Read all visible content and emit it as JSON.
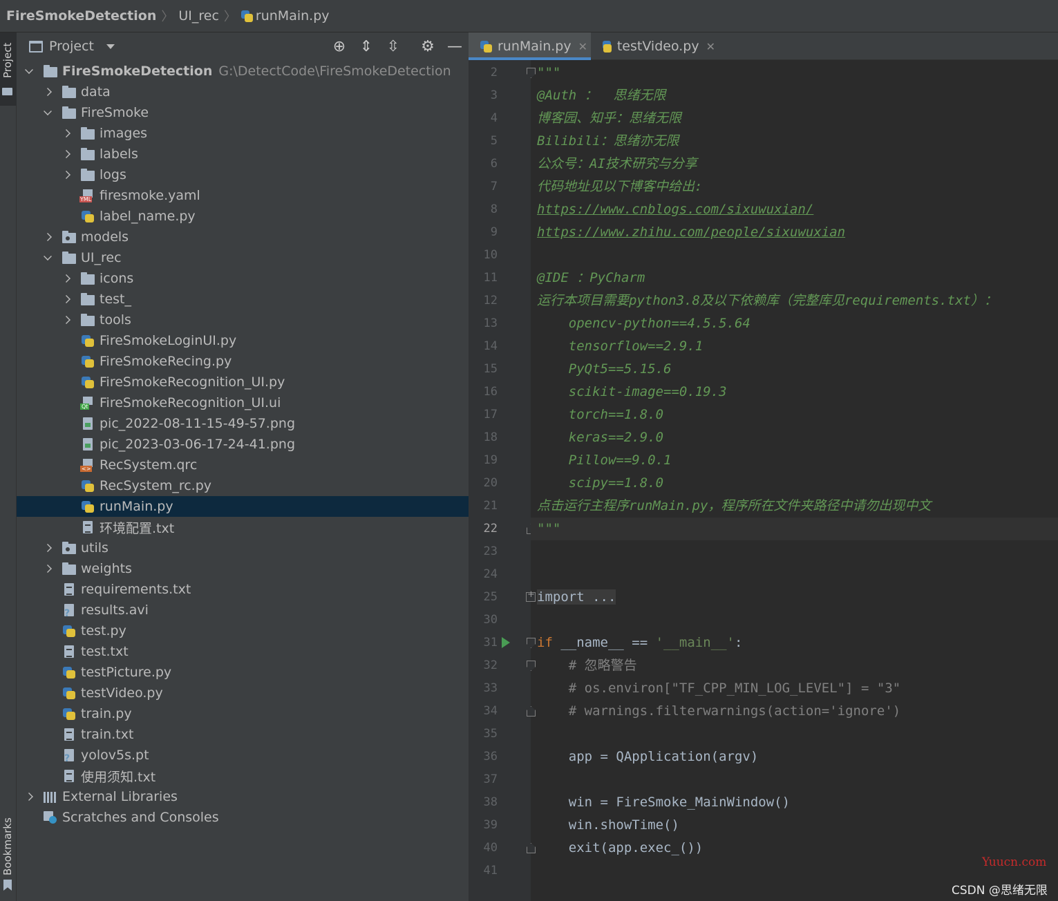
{
  "breadcrumb": [
    "FireSmokeDetection",
    "UI_rec",
    "runMain.py"
  ],
  "left_stripe": {
    "project_label": "Project",
    "bookmarks_label": "Bookmarks"
  },
  "project_panel": {
    "title": "Project",
    "tree": [
      {
        "name": "FireSmokeDetection",
        "path": "G:\\DetectCode\\FireSmokeDetection",
        "level": 0,
        "chevron": "down",
        "icon": "folder-icon",
        "bold": true
      },
      {
        "name": "data",
        "level": 1,
        "chevron": "right",
        "icon": "folder-icon"
      },
      {
        "name": "FireSmoke",
        "level": 1,
        "chevron": "down",
        "icon": "folder-icon"
      },
      {
        "name": "images",
        "level": 2,
        "chevron": "right",
        "icon": "folder-icon"
      },
      {
        "name": "labels",
        "level": 2,
        "chevron": "right",
        "icon": "folder-icon"
      },
      {
        "name": "logs",
        "level": 2,
        "chevron": "right",
        "icon": "folder-icon"
      },
      {
        "name": "firesmoke.yaml",
        "level": 2,
        "chevron": "none",
        "icon": "yaml-file-icon"
      },
      {
        "name": "label_name.py",
        "level": 2,
        "chevron": "none",
        "icon": "python-file-icon"
      },
      {
        "name": "models",
        "level": 1,
        "chevron": "right",
        "icon": "package-folder-icon"
      },
      {
        "name": "UI_rec",
        "level": 1,
        "chevron": "down",
        "icon": "folder-icon"
      },
      {
        "name": "icons",
        "level": 2,
        "chevron": "right",
        "icon": "folder-icon"
      },
      {
        "name": "test_",
        "level": 2,
        "chevron": "right",
        "icon": "folder-icon"
      },
      {
        "name": "tools",
        "level": 2,
        "chevron": "right",
        "icon": "folder-icon"
      },
      {
        "name": "FireSmokeLoginUI.py",
        "level": 2,
        "chevron": "none",
        "icon": "python-file-icon"
      },
      {
        "name": "FireSmokeRecing.py",
        "level": 2,
        "chevron": "none",
        "icon": "python-file-icon"
      },
      {
        "name": "FireSmokeRecognition_UI.py",
        "level": 2,
        "chevron": "none",
        "icon": "python-file-icon"
      },
      {
        "name": "FireSmokeRecognition_UI.ui",
        "level": 2,
        "chevron": "none",
        "icon": "qt-ui-file-icon"
      },
      {
        "name": "pic_2022-08-11-15-49-57.png",
        "level": 2,
        "chevron": "none",
        "icon": "image-file-icon"
      },
      {
        "name": "pic_2023-03-06-17-24-41.png",
        "level": 2,
        "chevron": "none",
        "icon": "image-file-icon"
      },
      {
        "name": "RecSystem.qrc",
        "level": 2,
        "chevron": "none",
        "icon": "qrc-file-icon"
      },
      {
        "name": "RecSystem_rc.py",
        "level": 2,
        "chevron": "none",
        "icon": "python-file-icon"
      },
      {
        "name": "runMain.py",
        "level": 2,
        "chevron": "none",
        "icon": "python-file-icon",
        "selected": true
      },
      {
        "name": "环境配置.txt",
        "level": 2,
        "chevron": "none",
        "icon": "text-file-icon"
      },
      {
        "name": "utils",
        "level": 1,
        "chevron": "right",
        "icon": "package-folder-icon"
      },
      {
        "name": "weights",
        "level": 1,
        "chevron": "right",
        "icon": "folder-icon"
      },
      {
        "name": "requirements.txt",
        "level": 1,
        "chevron": "none",
        "icon": "text-file-icon"
      },
      {
        "name": "results.avi",
        "level": 1,
        "chevron": "none",
        "icon": "unknown-file-icon"
      },
      {
        "name": "test.py",
        "level": 1,
        "chevron": "none",
        "icon": "python-file-icon"
      },
      {
        "name": "test.txt",
        "level": 1,
        "chevron": "none",
        "icon": "text-file-icon"
      },
      {
        "name": "testPicture.py",
        "level": 1,
        "chevron": "none",
        "icon": "python-file-icon"
      },
      {
        "name": "testVideo.py",
        "level": 1,
        "chevron": "none",
        "icon": "python-file-icon"
      },
      {
        "name": "train.py",
        "level": 1,
        "chevron": "none",
        "icon": "python-file-icon"
      },
      {
        "name": "train.txt",
        "level": 1,
        "chevron": "none",
        "icon": "text-file-icon"
      },
      {
        "name": "yolov5s.pt",
        "level": 1,
        "chevron": "none",
        "icon": "unknown-file-icon"
      },
      {
        "name": "使用须知.txt",
        "level": 1,
        "chevron": "none",
        "icon": "text-file-icon"
      },
      {
        "name": "External Libraries",
        "level": 0,
        "chevron": "right",
        "icon": "libraries-icon"
      },
      {
        "name": "Scratches and Consoles",
        "level": 0,
        "chevron": "none",
        "icon": "scratches-icon"
      }
    ]
  },
  "editor": {
    "tabs": [
      {
        "label": "runMain.py",
        "active": true
      },
      {
        "label": "testVideo.py",
        "active": false
      }
    ],
    "current_line": 22,
    "lines": [
      {
        "n": "2",
        "fold": "open",
        "spans": [
          [
            "doc",
            "\"\"\""
          ]
        ]
      },
      {
        "n": "3",
        "spans": [
          [
            "doc",
            "@Auth ：  思绪无限"
          ]
        ]
      },
      {
        "n": "4",
        "spans": [
          [
            "doc",
            "博客园、知乎：思绪无限"
          ]
        ]
      },
      {
        "n": "5",
        "spans": [
          [
            "doc",
            "Bilibili：思绪亦无限"
          ]
        ]
      },
      {
        "n": "6",
        "spans": [
          [
            "doc",
            "公众号：AI技术研究与分享"
          ]
        ]
      },
      {
        "n": "7",
        "spans": [
          [
            "doc",
            "代码地址见以下博客中给出:"
          ]
        ]
      },
      {
        "n": "8",
        "spans": [
          [
            "doc link",
            "https://www.cnblogs.com/sixuwuxian/"
          ]
        ]
      },
      {
        "n": "9",
        "spans": [
          [
            "doc link",
            "https://www.zhihu.com/people/sixuwuxian"
          ]
        ]
      },
      {
        "n": "10",
        "spans": []
      },
      {
        "n": "11",
        "spans": [
          [
            "doc",
            "@IDE ：PyCharm"
          ]
        ]
      },
      {
        "n": "12",
        "spans": [
          [
            "doc",
            "运行本项目需要python3.8及以下依赖库（完整库见requirements.txt）："
          ]
        ]
      },
      {
        "n": "13",
        "spans": [
          [
            "doc",
            "    opencv-python==4.5.5.64"
          ]
        ]
      },
      {
        "n": "14",
        "spans": [
          [
            "doc",
            "    tensorflow==2.9.1"
          ]
        ]
      },
      {
        "n": "15",
        "spans": [
          [
            "doc",
            "    PyQt5==5.15.6"
          ]
        ]
      },
      {
        "n": "16",
        "spans": [
          [
            "doc",
            "    scikit-image==0.19.3"
          ]
        ]
      },
      {
        "n": "17",
        "spans": [
          [
            "doc",
            "    torch==1.8.0"
          ]
        ]
      },
      {
        "n": "18",
        "spans": [
          [
            "doc",
            "    keras==2.9.0"
          ]
        ]
      },
      {
        "n": "19",
        "spans": [
          [
            "doc",
            "    Pillow==9.0.1"
          ]
        ]
      },
      {
        "n": "20",
        "spans": [
          [
            "doc",
            "    scipy==1.8.0"
          ]
        ]
      },
      {
        "n": "21",
        "spans": [
          [
            "doc",
            "点击运行主程序runMain.py，程序所在文件夹路径中请勿出现中文"
          ]
        ]
      },
      {
        "n": "22",
        "fold": "close",
        "spans": [
          [
            "doc",
            "\"\"\""
          ]
        ]
      },
      {
        "n": "23",
        "spans": []
      },
      {
        "n": "24",
        "spans": []
      },
      {
        "n": "25",
        "fold": "plus",
        "spans": [
          [
            "plain fold-box",
            "import ..."
          ]
        ]
      },
      {
        "n": "30",
        "spans": []
      },
      {
        "n": "31",
        "fold": "open",
        "run": true,
        "spans": [
          [
            "kw",
            "if "
          ],
          [
            "plain",
            "__name__ == "
          ],
          [
            "str",
            "'__main__'"
          ],
          [
            "plain",
            ":"
          ]
        ]
      },
      {
        "n": "32",
        "fold": "open",
        "spans": [
          [
            "cmt",
            "    # 忽略警告"
          ]
        ]
      },
      {
        "n": "33",
        "spans": [
          [
            "cmt",
            "    # os.environ[\"TF_CPP_MIN_LOG_LEVEL\"] = \"3\""
          ]
        ]
      },
      {
        "n": "34",
        "fold": "close",
        "spans": [
          [
            "cmt",
            "    # warnings.filterwarnings(action='ignore')"
          ]
        ]
      },
      {
        "n": "35",
        "spans": []
      },
      {
        "n": "36",
        "spans": [
          [
            "plain",
            "    app = QApplication(argv)"
          ]
        ]
      },
      {
        "n": "37",
        "spans": []
      },
      {
        "n": "38",
        "spans": [
          [
            "plain",
            "    win = FireSmoke_MainWindow()"
          ]
        ]
      },
      {
        "n": "39",
        "spans": [
          [
            "plain",
            "    win.showTime()"
          ]
        ]
      },
      {
        "n": "40",
        "fold": "close",
        "spans": [
          [
            "plain",
            "    exit(app.exec_())"
          ]
        ]
      },
      {
        "n": "41",
        "spans": []
      }
    ]
  },
  "watermarks": {
    "site": "Yuucn.com",
    "author": "CSDN @思绪无限"
  },
  "colors": {
    "selection": "#0d293e",
    "tab_underline": "#4a88c7",
    "docstring": "#629755",
    "keyword": "#cc7832",
    "string": "#6a8759",
    "comment": "#808080"
  }
}
